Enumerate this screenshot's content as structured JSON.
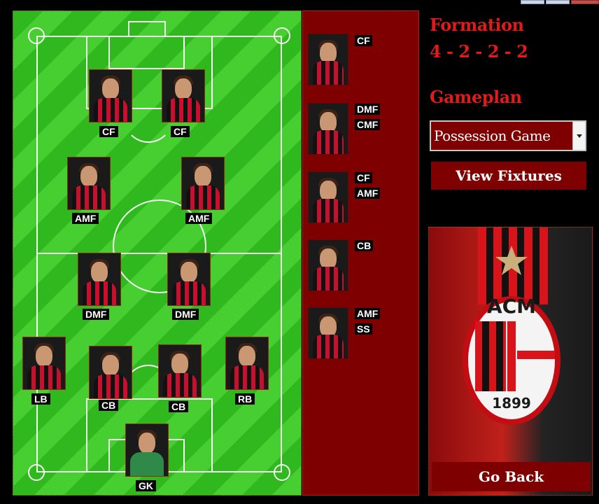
{
  "window": {
    "controls": [
      "minimize",
      "maximize",
      "close"
    ]
  },
  "pitch": {
    "players": [
      {
        "position": "CF"
      },
      {
        "position": "CF"
      },
      {
        "position": "AMF"
      },
      {
        "position": "AMF"
      },
      {
        "position": "DMF"
      },
      {
        "position": "DMF"
      },
      {
        "position": "LB"
      },
      {
        "position": "CB"
      },
      {
        "position": "CB"
      },
      {
        "position": "RB"
      },
      {
        "position": "GK"
      }
    ]
  },
  "bench": {
    "subs": [
      {
        "positions": [
          "CF"
        ]
      },
      {
        "positions": [
          "DMF",
          "CMF"
        ]
      },
      {
        "positions": [
          "CF",
          "AMF"
        ]
      },
      {
        "positions": [
          "CB"
        ]
      },
      {
        "positions": [
          "AMF",
          "SS"
        ]
      }
    ]
  },
  "formation": {
    "label": "Formation",
    "value": "4 - 2 - 2 - 2"
  },
  "gameplan": {
    "label": "Gameplan",
    "selected": "Possession Game"
  },
  "buttons": {
    "view_fixtures": "View Fixtures",
    "go_back": "Go Back"
  },
  "crest": {
    "letters": "ACM",
    "year": "1899"
  },
  "colors": {
    "accent_red": "#7e0000",
    "title_red": "#e21a1a",
    "pitch_green": "#30b81f",
    "pitch_green_light": "#47ce31"
  }
}
